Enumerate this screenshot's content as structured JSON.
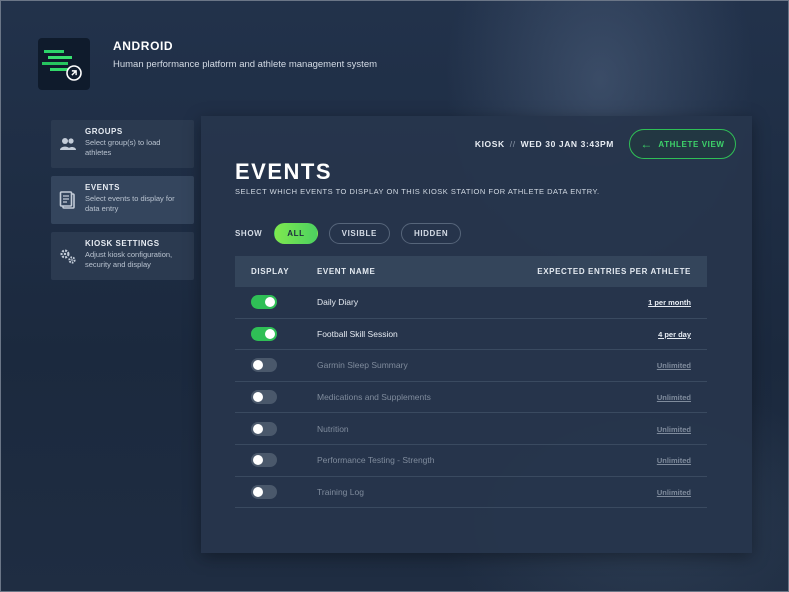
{
  "app": {
    "title": "ANDROID",
    "subtitle": "Human performance platform and athlete management system"
  },
  "sidebar": {
    "items": [
      {
        "label": "GROUPS",
        "desc_line1": "Select group(s) to load",
        "desc_line2": "athletes",
        "icon": "people-icon"
      },
      {
        "label": "EVENTS",
        "desc_line1": "Select events to display for",
        "desc_line2": "data entry",
        "icon": "clipboard-icon"
      },
      {
        "label": "KIOSK SETTINGS",
        "desc_line1": "Adjust kiosk configuration,",
        "desc_line2": "security and display",
        "icon": "gears-icon"
      }
    ]
  },
  "header": {
    "kiosk": "KIOSK",
    "separator": "//",
    "datetime": "WED 30 JAN 3:43PM",
    "athlete_view": "ATHLETE VIEW"
  },
  "page": {
    "title": "EVENTS",
    "subtitle": "SELECT WHICH EVENTS TO DISPLAY ON THIS KIOSK STATION FOR ATHLETE DATA ENTRY."
  },
  "filters": {
    "label": "SHOW",
    "options": [
      "ALL",
      "VISIBLE",
      "HIDDEN"
    ],
    "selected": "ALL"
  },
  "table": {
    "columns": [
      "DISPLAY",
      "EVENT NAME",
      "EXPECTED ENTRIES PER ATHLETE"
    ],
    "rows": [
      {
        "display": true,
        "name": "Daily Diary",
        "expected": "1 per month"
      },
      {
        "display": true,
        "name": "Football Skill Session",
        "expected": "4 per day"
      },
      {
        "display": false,
        "name": "Garmin Sleep Summary",
        "expected": "Unlimited"
      },
      {
        "display": false,
        "name": "Medications and Supplements",
        "expected": "Unlimited"
      },
      {
        "display": false,
        "name": "Nutrition",
        "expected": "Unlimited"
      },
      {
        "display": false,
        "name": "Performance Testing - Strength",
        "expected": "Unlimited"
      },
      {
        "display": false,
        "name": "Training Log",
        "expected": "Unlimited"
      }
    ]
  },
  "colors": {
    "accent_green": "#2fbf56",
    "background": "#1c2a40",
    "panel": "#26354c"
  }
}
